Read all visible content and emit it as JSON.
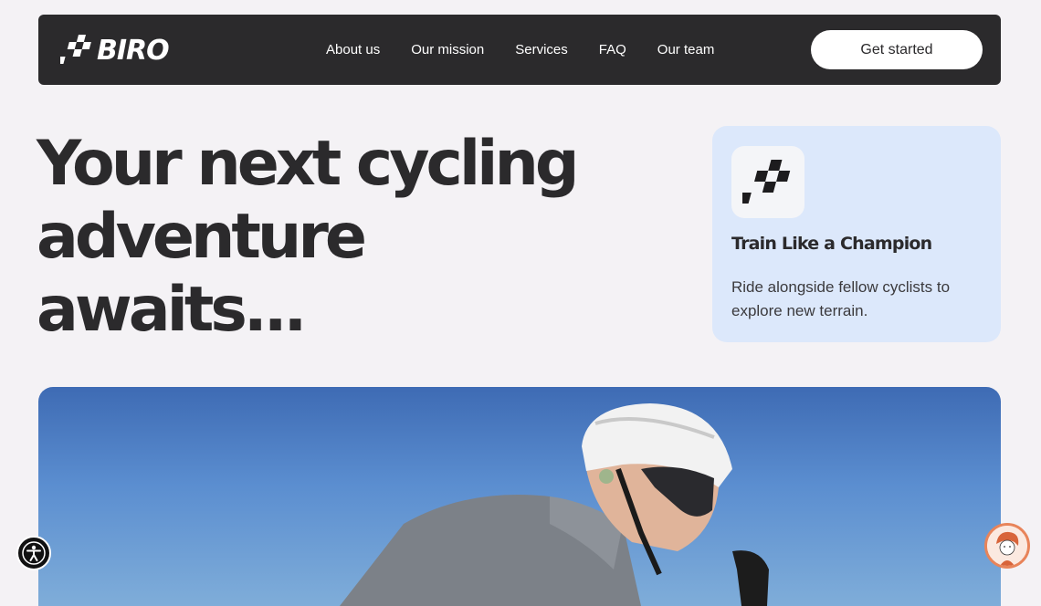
{
  "brand": {
    "name": "BIRO"
  },
  "nav": {
    "items": [
      {
        "label": "About us"
      },
      {
        "label": "Our mission"
      },
      {
        "label": "Services"
      },
      {
        "label": "FAQ"
      },
      {
        "label": "Our team"
      }
    ],
    "cta_label": "Get started"
  },
  "hero": {
    "headline_lines": [
      "Your next cycling",
      "adventure",
      "awaits..."
    ]
  },
  "card": {
    "icon": "checkered-flag-icon",
    "title": "Train Like a Champion",
    "description": "Ride alongside fellow cyclists to explore new terrain."
  },
  "widgets": {
    "accessibility_icon": "accessibility-icon",
    "chat_icon": "chat-avatar-icon"
  },
  "colors": {
    "navbar": "#2b2a2c",
    "background": "#f4f2f5",
    "card": "#dce8fb",
    "sky": "#5b8ed0"
  }
}
